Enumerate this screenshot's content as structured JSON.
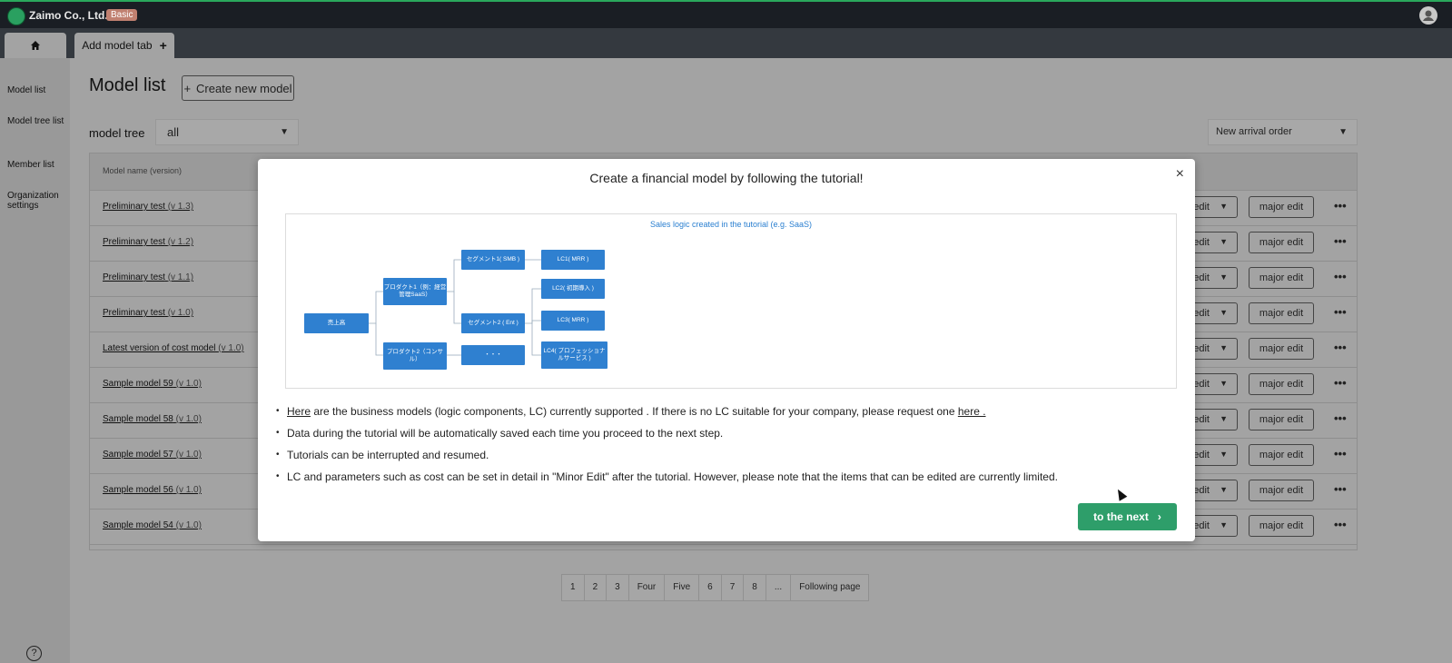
{
  "app": {
    "company": "Zaimo Co., Ltd.",
    "plan": "Basic"
  },
  "tabs": {
    "add_model_tab": "Add model tab"
  },
  "sidebar": {
    "items": [
      {
        "label": "Model list"
      },
      {
        "label": "Model tree list"
      },
      {
        "label": "Member list"
      },
      {
        "label": "Organization settings"
      }
    ]
  },
  "main": {
    "title": "Model list",
    "create_button": "Create new model",
    "filter_label": "model tree",
    "filter_value": "all",
    "sort_value": "New arrival order",
    "table_header_name": "Model name",
    "table_header_version": "(version)",
    "rows": [
      {
        "name": "Preliminary test",
        "version": "(v 1.3)"
      },
      {
        "name": "Preliminary test",
        "version": "(v 1.2)"
      },
      {
        "name": "Preliminary test",
        "version": "(v 1.1)"
      },
      {
        "name": "Preliminary test",
        "version": "(v 1.0)"
      },
      {
        "name": "Latest version of cost model",
        "version": "(v 1.0)"
      },
      {
        "name": "Sample model 59",
        "version": "(v 1.0)"
      },
      {
        "name": "Sample model 58",
        "version": "(v 1.0)"
      },
      {
        "name": "Sample model 57",
        "version": "(v 1.0)"
      },
      {
        "name": "Sample model 56",
        "version": "(v 1.0)"
      },
      {
        "name": "Sample model 54",
        "version": "(v 1.0)"
      }
    ],
    "minor_label": "edit",
    "major_label": "major edit",
    "more_label": "•••"
  },
  "pagination": [
    "1",
    "2",
    "3",
    "Four",
    "Five",
    "6",
    "7",
    "8",
    "...",
    "Following page"
  ],
  "modal": {
    "title": "Create a financial model by following the tutorial!",
    "close": "×",
    "diagram_title": "Sales logic created in the tutorial (e.g. SaaS)",
    "nodes": {
      "root": "売上高",
      "p1": "プロダクト1（例：経営管理SaaS）",
      "p2": "プロダクト2（コンサル）",
      "s1": "セグメント1( SMB )",
      "s2": "セグメント2 ( Ent )",
      "dots": "・・・",
      "lc1": "LC1( MRR )",
      "lc2": "LC2( 初期導入 )",
      "lc3": "LC3( MRR )",
      "lc4": "LC4( プロフェッショナルサービス )"
    },
    "bullet1_link": "Here",
    "bullet1_text": " are the business models (logic components, LC) currently supported . If there is no LC suitable for your company, please request one ",
    "bullet1_link2": "here .",
    "bullet2": "Data during the tutorial will be automatically saved each time you proceed to the next step.",
    "bullet3": "Tutorials can be interrupted and resumed.",
    "bullet4": "LC and parameters such as cost can be set in detail in \"Minor Edit\" after the tutorial. However, please note that the items that can be edited are currently limited.",
    "next_button": "to the next"
  }
}
